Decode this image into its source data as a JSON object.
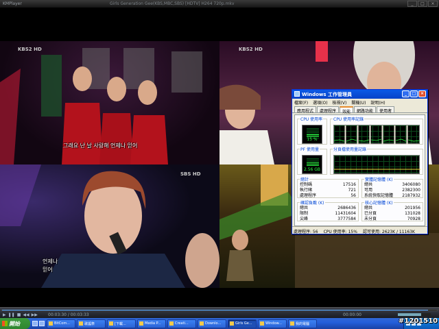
{
  "player": {
    "app_name": "KMPlayer",
    "file_title": "Girls Generation Gee(KBS,MBC,SBS) [HDTV] H264 720p.mkv"
  },
  "videos": {
    "q1": {
      "broadcaster": "KBS2 HD",
      "subtitle": "그래요 난 날 사랑해 언제나 믿어"
    },
    "q2": {
      "broadcaster": "KBS2 HD"
    },
    "q3": {
      "broadcaster": "SBS HD",
      "subtitle_line1": "언제나",
      "subtitle_line2": "믿어"
    },
    "q4": {}
  },
  "task_manager": {
    "title": "Windows 工作管理員",
    "menu": [
      "檔案(F)",
      "選項(O)",
      "檢視(V)",
      "關機(U)",
      "說明(H)"
    ],
    "tabs": [
      "應用程式",
      "處理程序",
      "效能",
      "網路功能",
      "使用者"
    ],
    "active_tab": "效能",
    "cpu_usage_legend": "CPU 使用率",
    "cpu_usage_value": "15 %",
    "cpu_fraction": 0.15,
    "cpu_history_legend": "CPU 使用率記錄",
    "pf_usage_legend": "PF 使用量",
    "pf_usage_value": "2.56 GB",
    "pf_history_legend": "分頁檔使用量記錄",
    "totals": {
      "legend": "總計",
      "rows": [
        {
          "label": "控制碼",
          "value": "17516"
        },
        {
          "label": "執行緒",
          "value": "721"
        },
        {
          "label": "處理程序",
          "value": "56"
        }
      ]
    },
    "physical_memory": {
      "legend": "實體記憶體 (K)",
      "rows": [
        {
          "label": "總共",
          "value": "3406080"
        },
        {
          "label": "可用",
          "value": "2382300"
        },
        {
          "label": "系統快取記憶體",
          "value": "2187932"
        }
      ]
    },
    "commit_charge": {
      "legend": "確認負載 (K)",
      "rows": [
        {
          "label": "總共",
          "value": "2686436"
        },
        {
          "label": "限制",
          "value": "11431604"
        },
        {
          "label": "尖峰",
          "value": "3777584"
        }
      ]
    },
    "kernel_memory": {
      "legend": "核心記憶體 (K)",
      "rows": [
        {
          "label": "總共",
          "value": "201956"
        },
        {
          "label": "已分頁",
          "value": "131028"
        },
        {
          "label": "未分頁",
          "value": "70928"
        }
      ]
    },
    "status": {
      "processes": "處理程序: 56",
      "cpu": "CPU 使用率: 15%",
      "commit": "認可使用: 2623K / 11163K"
    }
  },
  "controls": {
    "time_current": "00:03:30 / 00:03:33",
    "time_right": "00:00:00",
    "progress": 0.98,
    "volume": 0.7
  },
  "taskbar": {
    "start_label": "開始",
    "tasks": [
      "BitCom...",
      "歌謠祭",
      "[下載...",
      "Media P...",
      "Creati...",
      "Downlo...",
      "Girls Ge...",
      "Window...",
      "我的電腦"
    ]
  },
  "watermark": "#1201510"
}
